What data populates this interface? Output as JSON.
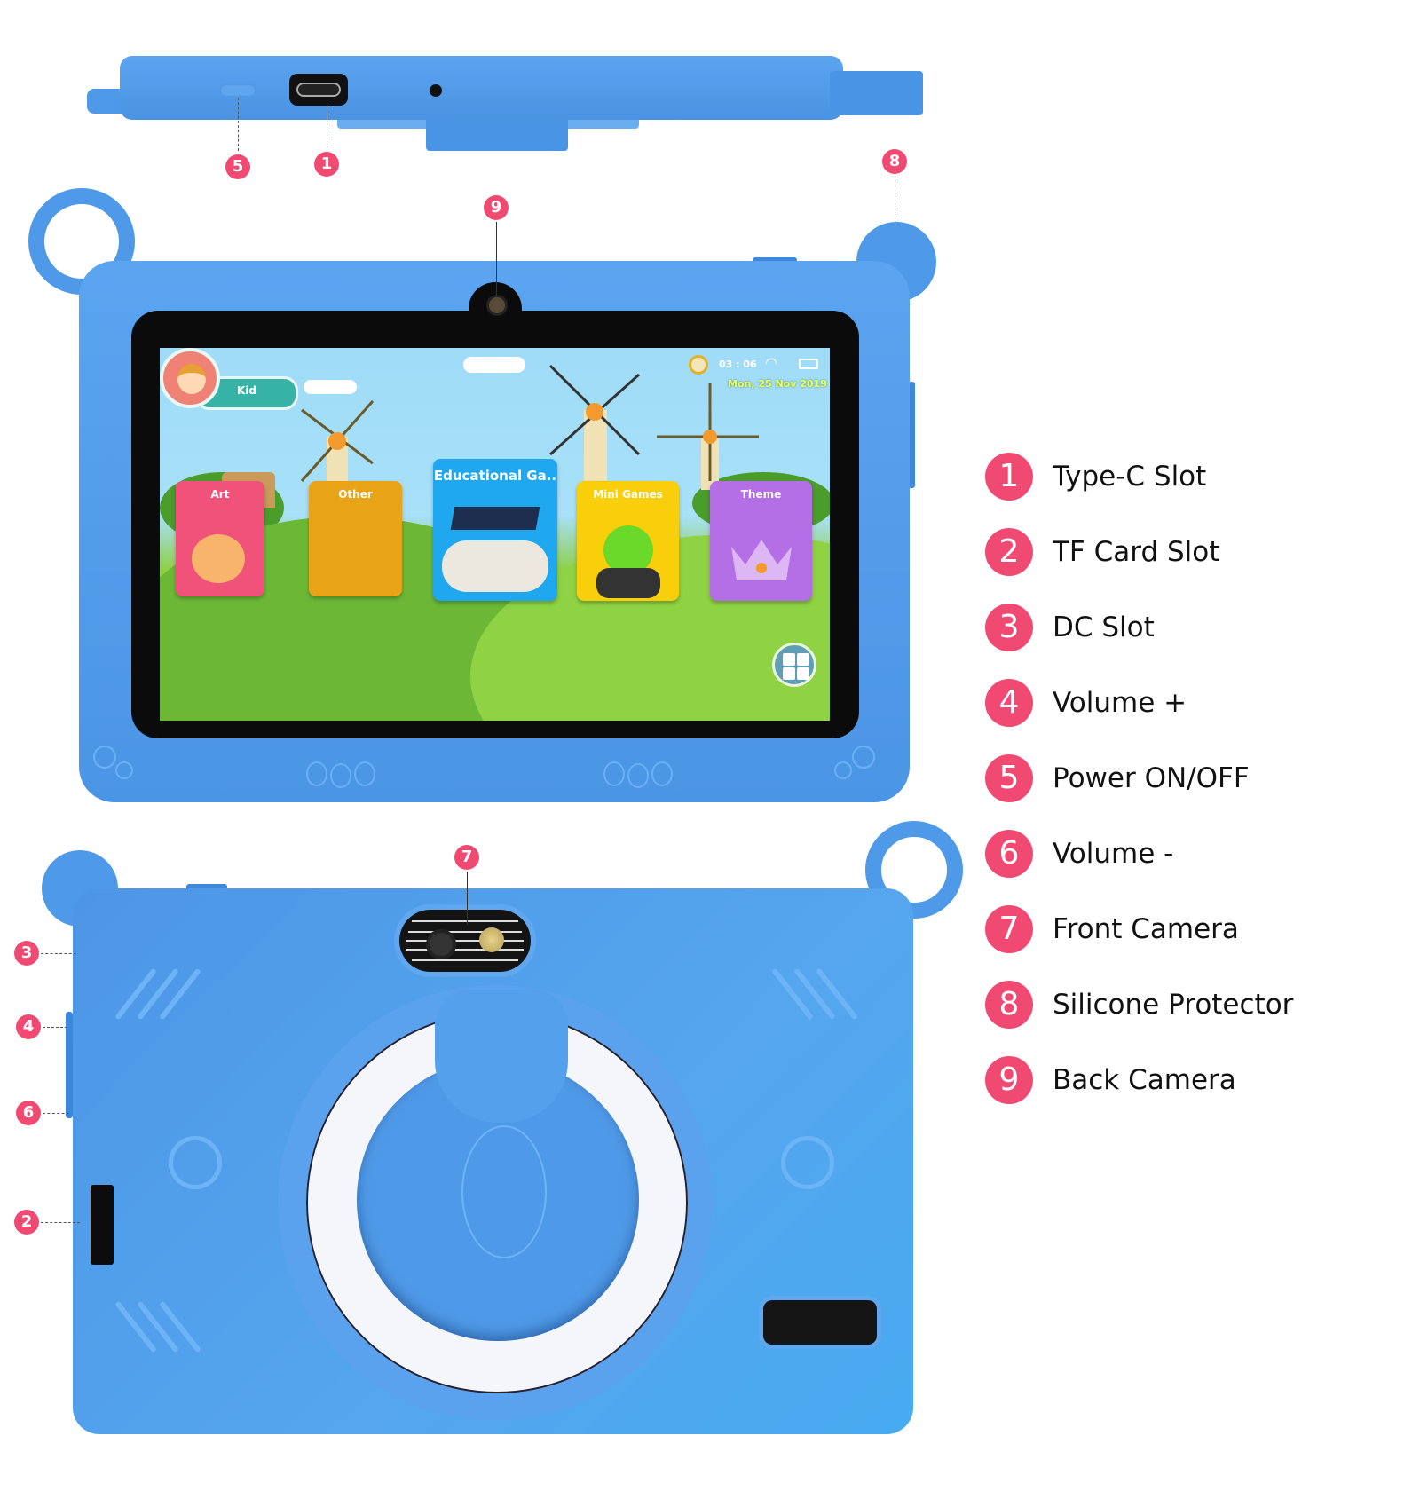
{
  "legend": [
    {
      "num": "1",
      "label": "Type-C Slot"
    },
    {
      "num": "2",
      "label": "TF Card Slot"
    },
    {
      "num": "3",
      "label": "DC Slot"
    },
    {
      "num": "4",
      "label": "Volume +"
    },
    {
      "num": "5",
      "label": "Power ON/OFF"
    },
    {
      "num": "6",
      "label": "Volume -"
    },
    {
      "num": "7",
      "label": "Front Camera"
    },
    {
      "num": "8",
      "label": "Silicone Protector"
    },
    {
      "num": "9",
      "label": "Back Camera"
    }
  ],
  "callouts": {
    "top_power": "5",
    "top_typec": "1",
    "protector": "8",
    "back_camera": "9",
    "front_camera": "7",
    "dc_slot": "3",
    "volume_up": "4",
    "volume_down": "6",
    "tf_slot": "2"
  },
  "screen": {
    "profile_name": "Kid",
    "time": "03 : 06",
    "date": "Mon, 25 Nov 2019",
    "wifi_icon": "wifi-icon",
    "apps": [
      {
        "label": "Art",
        "color": "#f0527a",
        "icon": "palette-icon"
      },
      {
        "label": "Other",
        "color": "#e9a317",
        "icon": "folder-icon"
      },
      {
        "label": "Educational Ga..",
        "color": "#1fa8f0",
        "icon": "gamepad-graduation-cap-icon"
      },
      {
        "label": "Mini Games",
        "color": "#f9cf0c",
        "icon": "bunny-gamer-icon"
      },
      {
        "label": "Theme",
        "color": "#b46ee6",
        "icon": "crown-icon"
      }
    ],
    "all_apps_icon": "grid-icon"
  },
  "colors": {
    "case_blue": "#4f9ae8",
    "badge_pink": "#f14a72"
  }
}
